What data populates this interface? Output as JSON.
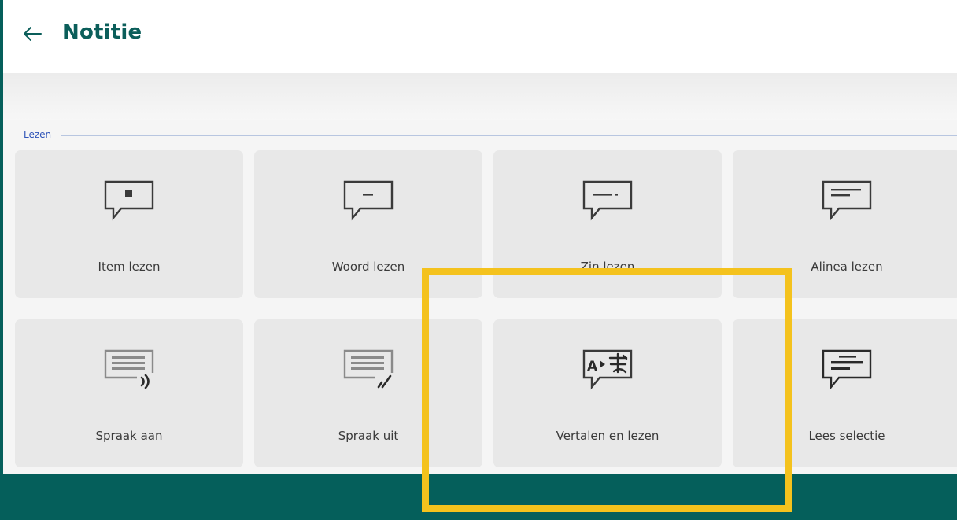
{
  "header": {
    "title": "Notitie",
    "back_icon": "arrow-left-icon"
  },
  "section": {
    "label": "Lezen"
  },
  "tiles": [
    {
      "label": "Item lezen",
      "icon": "speech-bubble-dot-icon"
    },
    {
      "label": "Woord lezen",
      "icon": "speech-bubble-dash-icon"
    },
    {
      "label": "Zin lezen",
      "icon": "speech-bubble-sentence-icon"
    },
    {
      "label": "Alinea lezen",
      "icon": "speech-bubble-paragraph-icon"
    },
    {
      "label": "Spraak aan",
      "icon": "speech-on-icon"
    },
    {
      "label": "Spraak uit",
      "icon": "speech-off-icon"
    },
    {
      "label": "Vertalen en lezen",
      "icon": "translate-icon"
    },
    {
      "label": "Lees selectie",
      "icon": "read-selection-icon"
    }
  ],
  "colors": {
    "accent": "#055f5b",
    "highlight": "#f4c21d",
    "tile": "#e8e8e8"
  }
}
